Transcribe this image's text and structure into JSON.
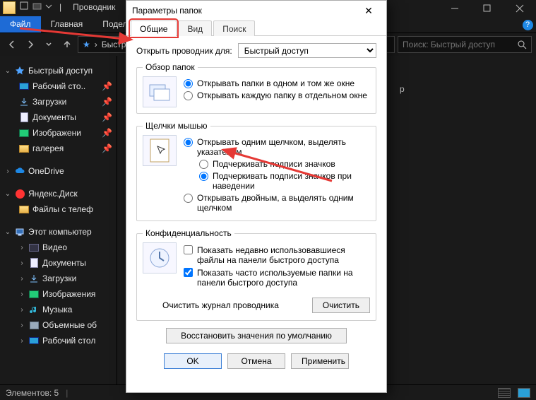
{
  "explorer": {
    "title_sep": "|",
    "title": "Проводник",
    "ribbon": {
      "file": "Файл",
      "home": "Главная",
      "share": "Подел"
    },
    "address_text": "Быстр",
    "search_placeholder": "Поиск: Быстрый доступ",
    "status": "Элементов: 5",
    "content_hint": "р",
    "nav": {
      "quick": "Быстрый доступ",
      "desktop": "Рабочий сто..",
      "downloads": "Загрузки",
      "documents": "Документы",
      "pictures": "Изображени",
      "gallery": "галерея",
      "onedrive": "OneDrive",
      "yadisk": "Яндекс.Диск",
      "yadisk_files": "Файлы с телеф",
      "thispc": "Этот компьютер",
      "video": "Видео",
      "documents2": "Документы",
      "downloads2": "Загрузки",
      "pictures2": "Изображения",
      "music": "Музыка",
      "volumes": "Объемные об",
      "desktop2": "Рабочий стол"
    }
  },
  "dialog": {
    "title": "Параметры папок",
    "tabs": {
      "general": "Общие",
      "view": "Вид",
      "search": "Поиск"
    },
    "open_explorer_for": "Открыть проводник для:",
    "open_explorer_select": "Быстрый доступ",
    "browse_legend": "Обзор папок",
    "browse_same": "Открывать папки в одном и том же окне",
    "browse_new": "Открывать каждую папку в отдельном окне",
    "click_legend": "Щелчки мышью",
    "click_single": "Открывать одним щелчком, выделять указателем",
    "click_underline_always": "Подчеркивать подписи значков",
    "click_underline_hover": "Подчеркивать подписи значков при наведении",
    "click_double": "Открывать двойным, а выделять одним щелчком",
    "privacy_legend": "Конфиденциальность",
    "privacy_recent": "Показать недавно использовавшиеся файлы на панели быстрого доступа",
    "privacy_frequent": "Показать часто используемые папки на панели быстрого доступа",
    "clear_label": "Очистить журнал проводника",
    "clear_btn": "Очистить",
    "restore_defaults": "Восстановить значения по умолчанию",
    "ok": "OK",
    "cancel": "Отмена",
    "apply": "Применить"
  }
}
